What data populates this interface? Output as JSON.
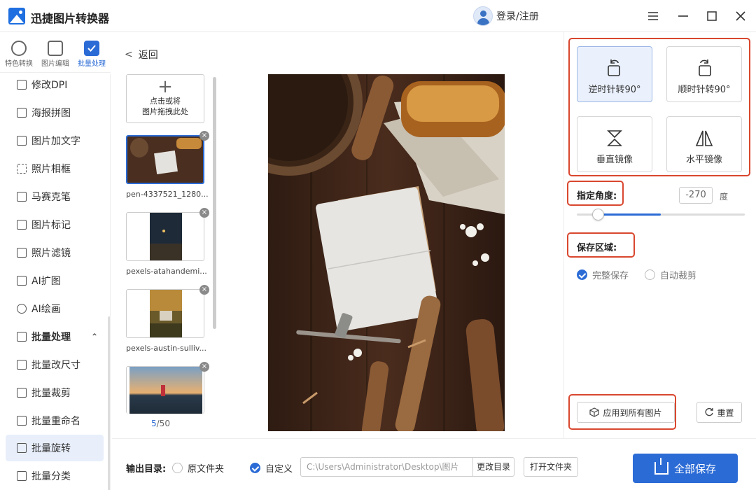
{
  "app": {
    "title": "迅捷图片转换器",
    "user_label": "登录/注册"
  },
  "tool_tabs": [
    {
      "label": "特色转换"
    },
    {
      "label": "图片编辑"
    },
    {
      "label": "批量处理"
    }
  ],
  "nav": {
    "items": [
      {
        "label": "修改DPI"
      },
      {
        "label": "海报拼图"
      },
      {
        "label": "图片加文字"
      },
      {
        "label": "照片相框"
      },
      {
        "label": "马赛克笔"
      },
      {
        "label": "图片标记"
      },
      {
        "label": "照片滤镜"
      },
      {
        "label": "AI扩图"
      },
      {
        "label": "AI绘画"
      },
      {
        "label": "批量处理"
      },
      {
        "label": "批量改尺寸"
      },
      {
        "label": "批量裁剪"
      },
      {
        "label": "批量重命名"
      },
      {
        "label": "批量旋转"
      },
      {
        "label": "批量分类"
      }
    ]
  },
  "thumbs": {
    "back_label": "返回",
    "add_line1": "点击或将",
    "add_line2": "图片拖拽此处",
    "files": [
      {
        "name": "pen-4337521_1280..."
      },
      {
        "name": "pexels-atahandemi..."
      },
      {
        "name": "pexels-austin-sulliv..."
      }
    ],
    "page_current": "5",
    "page_total": "/50"
  },
  "rotate": {
    "ccw_label": "逆时针转90°",
    "cw_label": "顺时针转90°",
    "vflip_label": "垂直镜像",
    "hflip_label": "水平镜像",
    "angle_label": "指定角度:",
    "angle_value": "-270",
    "angle_unit": "度",
    "angle_slider_fraction": 0.125,
    "area_label": "保存区域:",
    "area_full": "完整保存",
    "area_crop": "自动裁剪",
    "apply_label": "应用到所有图片",
    "reset_label": "重置"
  },
  "output": {
    "label": "输出目录:",
    "opt_original": "原文件夹",
    "opt_custom": "自定义",
    "path_value": "C:\\Users\\Administrator\\Desktop\\图片",
    "change_dir": "更改目录",
    "open_folder": "打开文件夹",
    "save_all": "全部保存"
  },
  "colors": {
    "accent": "#2b6bd6",
    "highlight": "#d9472f"
  }
}
